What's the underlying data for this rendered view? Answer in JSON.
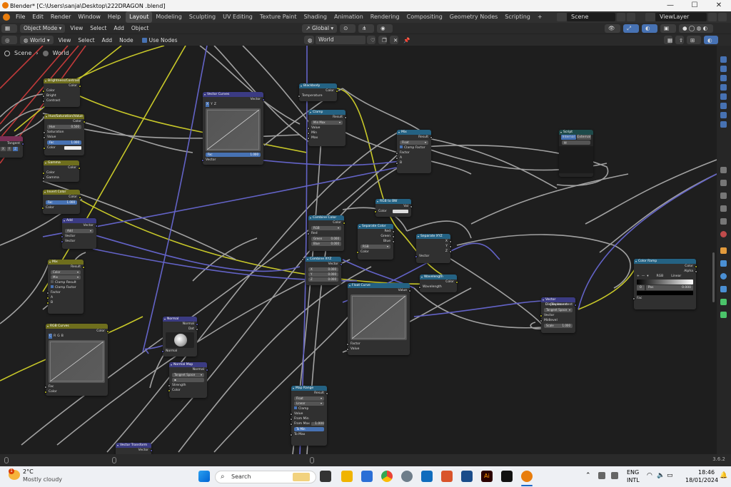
{
  "window": {
    "title": "Blender* [C:\\Users\\sanja\\Desktop\\222DRAGON .blend]",
    "minimize": "—",
    "maximize": "☐",
    "close": "✕"
  },
  "topbar": {
    "menus": [
      "File",
      "Edit",
      "Render",
      "Window",
      "Help"
    ],
    "workspaces": [
      "Layout",
      "Modeling",
      "Sculpting",
      "UV Editing",
      "Texture Paint",
      "Shading",
      "Animation",
      "Rendering",
      "Compositing",
      "Geometry Nodes",
      "Scripting"
    ],
    "add_tab": "+",
    "scene": "Scene",
    "view_layer": "ViewLayer"
  },
  "header": {
    "mode": "Object Mode",
    "view": "View",
    "select": "Select",
    "add": "Add",
    "object": "Object",
    "orientation": "Global"
  },
  "node_header": {
    "type": "World",
    "view": "View",
    "select": "Select",
    "add": "Add",
    "node": "Node",
    "use_nodes": "Use Nodes",
    "world_name": "World"
  },
  "breadcrumb": {
    "scene": "Scene",
    "world": "World"
  },
  "nodes": {
    "brightness": {
      "title": "Brightness/Contrast",
      "out": "Color",
      "in": [
        "Color",
        "Bright",
        "Contrast"
      ]
    },
    "hsv": {
      "title": "Hue/Saturation/Value",
      "out": "Color",
      "hue": "Hue",
      "hue_val": "0.500",
      "in": [
        "Saturation",
        "Value"
      ],
      "fac": "Fac",
      "fac_val": "1.000",
      "color": "Color"
    },
    "gamma": {
      "title": "Gamma",
      "out": "Color",
      "in": [
        "Color",
        "Gamma"
      ]
    },
    "invert": {
      "title": "Invert Color",
      "out": "Color",
      "fac": "Fac",
      "fac_val": "1.000",
      "color": "Color"
    },
    "tangent": {
      "title": "",
      "out": "Tangent",
      "axes": [
        "X",
        "Y",
        "Z"
      ]
    },
    "add": {
      "title": "Add",
      "out": "Vector",
      "op": "Add",
      "in": [
        "Vector",
        "Vector"
      ]
    },
    "mix_left": {
      "title": "Mix",
      "out": "Result",
      "type": "Color",
      "blend": "Mix",
      "clamp_result": "Clamp Result",
      "clamp_factor": "Clamp Factor",
      "in": [
        "Factor",
        "A",
        "B"
      ]
    },
    "rgb_curves": {
      "title": "RGB Curves",
      "out": "Color",
      "chans": [
        "C",
        "R",
        "G",
        "B"
      ],
      "in": [
        "Fac",
        "Color"
      ]
    },
    "vector_curves": {
      "title": "Vector Curves",
      "out": "Vector",
      "chans": [
        "X",
        "Y",
        "Z"
      ],
      "fac": "Fac",
      "fac_val": "1.000",
      "in": "Vector"
    },
    "normal": {
      "title": "Normal",
      "outs": [
        "Normal",
        "Dot"
      ],
      "in": "Normal"
    },
    "normal_map": {
      "title": "Normal Map",
      "out": "Normal",
      "space": "Tangent Space",
      "in": [
        "Strength",
        "Color"
      ]
    },
    "blackbody": {
      "title": "Blackbody",
      "out": "Color",
      "in": "Temperature"
    },
    "clamp": {
      "title": "Clamp",
      "out": "Result",
      "type": "Min Max",
      "in": [
        "Value",
        "Min",
        "Max"
      ]
    },
    "mix_right": {
      "title": "Mix",
      "out": "Result",
      "type": "Float",
      "clamp": "Clamp Factor",
      "in": [
        "Factor",
        "A",
        "B"
      ]
    },
    "script": {
      "title": "Script",
      "internal": "Internal",
      "external": "External"
    },
    "rgb_to_bw": {
      "title": "RGB to BW",
      "out": "Val",
      "in": "Color"
    },
    "combine_color": {
      "title": "Combine Color",
      "out": "Color",
      "mode": "RGB",
      "in": [
        "Red"
      ],
      "green": "Green",
      "green_val": "0.000",
      "blue": "Blue",
      "blue_val": "0.000"
    },
    "separate_color": {
      "title": "Separate Color",
      "outs": [
        "Red",
        "Green",
        "Blue"
      ],
      "mode": "RGB",
      "in": "Color"
    },
    "separate_xyz": {
      "title": "Separate XYZ",
      "outs": [
        "X",
        "Y",
        "Z"
      ],
      "in": "Vector"
    },
    "combine_xyz": {
      "title": "Combine XYZ",
      "out": "Vector",
      "rows": [
        {
          "k": "X",
          "v": "0.000"
        },
        {
          "k": "Y",
          "v": "0.000"
        },
        {
          "k": "Z",
          "v": "0.000"
        }
      ]
    },
    "wavelength": {
      "title": "Wavelength",
      "out": "Color",
      "in": "Wavelength"
    },
    "float_curve": {
      "title": "Float Curve",
      "out": "Value",
      "in": [
        "Factor",
        "Value"
      ]
    },
    "map_range": {
      "title": "Map Range",
      "out": "Result",
      "type": "Float",
      "interp": "Linear",
      "clamp": "Clamp",
      "in": [
        "Value",
        "From Min",
        "From Max"
      ],
      "from_max_val": "1.000",
      "to_min": "To Min",
      "to_min_val": "",
      "to_max": "To Max"
    },
    "vector_transform": {
      "title": "Vector Transform",
      "out": "Vector"
    },
    "vector_displacement": {
      "title": "Vector Displacement",
      "out": "Displacement",
      "space": "Tangent Space",
      "in": [
        "Vector",
        "Midlevel"
      ],
      "scale": "Scale",
      "scale_val": "1.000"
    },
    "color_ramp": {
      "title": "Color Ramp",
      "outs": [
        "Color",
        "Alpha"
      ],
      "add": "+",
      "remove": "—",
      "mode": "RGB",
      "interp": "Linear",
      "stop": "0",
      "pos": "Pos",
      "pos_val": "0.000",
      "in": "Fac"
    }
  },
  "status": {
    "version": "3.6.2"
  },
  "taskbar": {
    "temp": "2°C",
    "weather": "Mostly cloudy",
    "search": "Search",
    "lang": "ENG",
    "layout": "INTL",
    "time": "18:46",
    "date": "18/01/2024",
    "badge": "1"
  }
}
